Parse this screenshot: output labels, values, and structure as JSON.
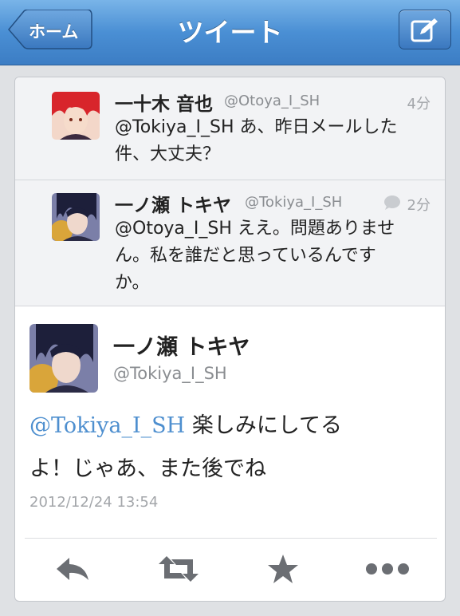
{
  "navbar": {
    "title": "ツイート",
    "back_label": "ホーム",
    "compose_icon": "compose-icon"
  },
  "replies": [
    {
      "name": "一十木 音也",
      "handle": "@Otoya_I_SH",
      "time": "4分",
      "text_line1": "@Tokiya_I_SH あ、昨日メールした",
      "text_line2": "件、大丈夫？"
    },
    {
      "name": "一ノ瀬 トキヤ",
      "handle": "@Tokiya_I_SH",
      "time": "2分",
      "text_line1": "@Otoya_I_SH ええ。問題ありませ",
      "text_line2": "ん。私を誰だと思っているんです",
      "text_line3": "か。"
    }
  ],
  "main_tweet": {
    "name": "一ノ瀬 トキヤ",
    "handle": "@Tokiya_I_SH",
    "mention": "@Tokiya_I_SH",
    "text_after_mention": " 楽しみにしてる",
    "text_line2": "よ！じゃあ、また後でね",
    "date": "2012/12/24 13:54"
  },
  "actions": [
    "reply-icon",
    "retweet-icon",
    "favorite-star-icon",
    "more-icon"
  ],
  "colors": {
    "navbar": "#4a8fd4",
    "mention": "#4e8fcf"
  }
}
